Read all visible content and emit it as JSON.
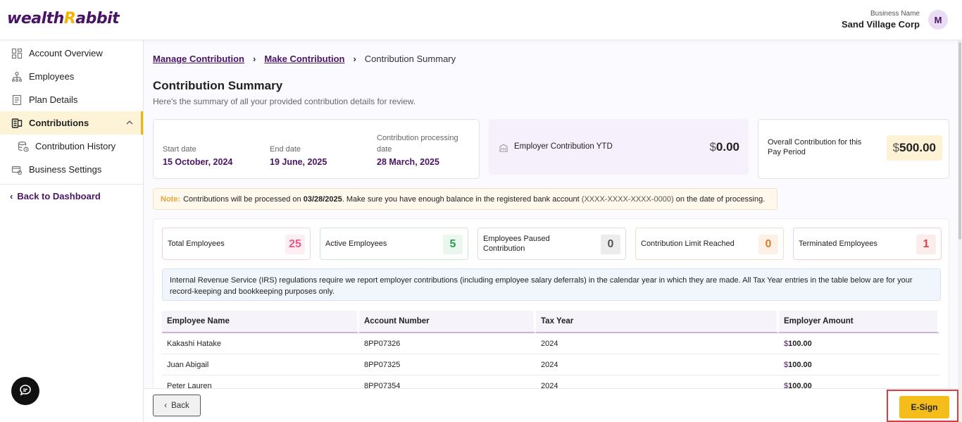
{
  "brand": {
    "logo_text_pre": "wealth",
    "logo_text_r": "R",
    "logo_text_post": "abbit"
  },
  "header": {
    "business_label": "Business Name",
    "business_name": "Sand Village Corp",
    "avatar_initial": "M"
  },
  "sidebar": {
    "items": [
      {
        "label": "Account Overview"
      },
      {
        "label": "Employees"
      },
      {
        "label": "Plan Details"
      },
      {
        "label": "Contributions"
      },
      {
        "label": "Contribution History"
      },
      {
        "label": "Business Settings"
      }
    ],
    "back_label": "Back to Dashboard"
  },
  "breadcrumb": {
    "item1": "Manage Contribution",
    "item2": "Make Contribution",
    "current": "Contribution Summary"
  },
  "page": {
    "title": "Contribution Summary",
    "subtitle": "Here's the summary of all your provided contribution details for review."
  },
  "dates": {
    "start_label": "Start date",
    "start_value": "15 October, 2024",
    "end_label": "End date",
    "end_value": "19 June, 2025",
    "processing_label": "Contribution processing date",
    "processing_value": "28 March, 2025"
  },
  "ytd": {
    "label": "Employer Contribution YTD",
    "currency": "$",
    "value": "0.00"
  },
  "overall": {
    "label": "Overall Contribution for this Pay Period",
    "currency": "$",
    "value": "500.00"
  },
  "note": {
    "label": "Note:",
    "text1": "Contributions will be processed on",
    "date": "03/28/2025",
    "text2": ". Make sure you have enough balance in the registered bank account",
    "account": "(XXXX-XXXX-XXXX-0000)",
    "text3": "on the date of processing."
  },
  "stats": [
    {
      "label": "Total Employees",
      "value": "25"
    },
    {
      "label": "Active Employees",
      "value": "5"
    },
    {
      "label": "Employees Paused Contribution",
      "value": "0"
    },
    {
      "label": "Contribution Limit Reached",
      "value": "0"
    },
    {
      "label": "Terminated Employees",
      "value": "1"
    }
  ],
  "irs_notice": "Internal Revenue Service (IRS) regulations require we report employer contributions (including employee salary deferrals) in the calendar year in which they are made. All Tax Year entries in the table below are for your record-keeping and bookkeeping purposes only.",
  "table": {
    "headers": [
      "Employee Name",
      "Account Number",
      "Tax Year",
      "Employer Amount"
    ],
    "rows": [
      {
        "name": "Kakashi Hatake",
        "account": "8PP07326",
        "tax_year": "2024",
        "currency": "$",
        "amount": "100.00"
      },
      {
        "name": "Juan Abigail",
        "account": "8PP07325",
        "tax_year": "2024",
        "currency": "$",
        "amount": "100.00"
      },
      {
        "name": "Peter Lauren",
        "account": "8PP07354",
        "tax_year": "2024",
        "currency": "$",
        "amount": "100.00"
      }
    ]
  },
  "footer": {
    "back_label": "Back",
    "esign_label": "E-Sign"
  },
  "colors": {
    "brand_purple": "#4a1466",
    "accent_yellow": "#f5bd1a",
    "highlight_red": "#e23a3a"
  }
}
